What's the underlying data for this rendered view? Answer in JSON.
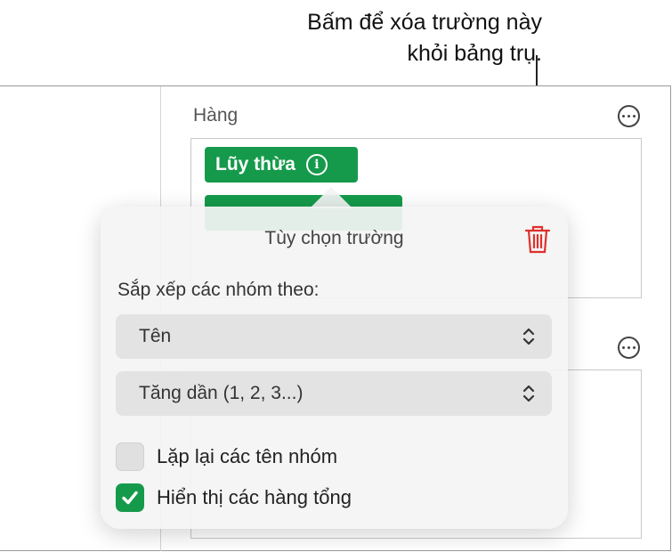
{
  "callout": {
    "line1": "Bấm để xóa trường này",
    "line2": "khỏi bảng trụ."
  },
  "panel": {
    "section_label": "Hàng",
    "fields": [
      {
        "label": "Lũy thừa",
        "icon": "info-icon"
      },
      {
        "label": "",
        "icon": "info-icon"
      }
    ]
  },
  "popover": {
    "title": "Tùy chọn trường",
    "sort_label": "Sắp xếp các nhóm theo:",
    "sort_by": {
      "value": "Tên"
    },
    "sort_order": {
      "value": "Tăng dần (1, 2, 3...)"
    },
    "options": [
      {
        "label": "Lặp lại các tên nhóm",
        "checked": false
      },
      {
        "label": "Hiển thị các hàng tổng",
        "checked": true
      }
    ]
  },
  "colors": {
    "accent_green": "#159a4b",
    "delete_red": "#e0302c"
  }
}
